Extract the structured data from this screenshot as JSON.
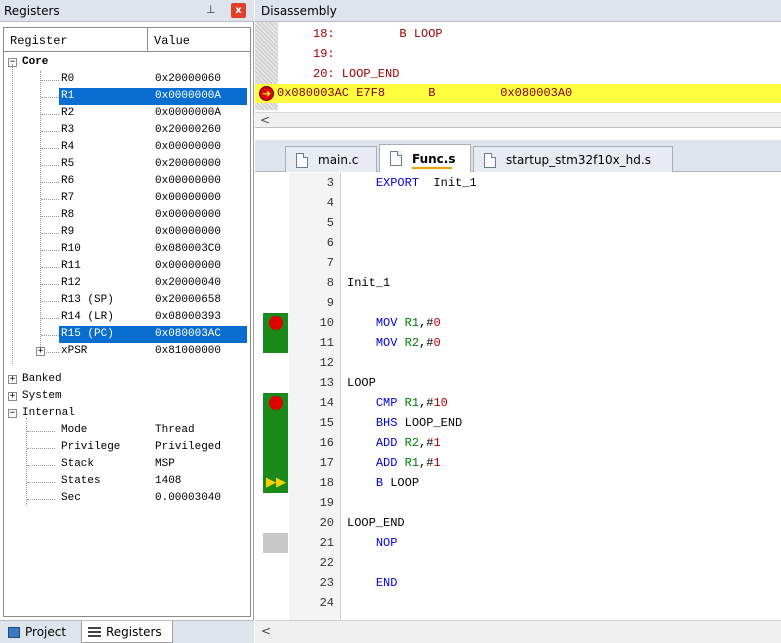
{
  "registers_panel": {
    "title": "Registers",
    "pin_glyph": "⊥",
    "close_glyph": "x",
    "col_register": "Register",
    "col_value": "Value",
    "core_label": "Core",
    "core": [
      {
        "name": "R0",
        "value": "0x20000060"
      },
      {
        "name": "R1",
        "value": "0x0000000A"
      },
      {
        "name": "R2",
        "value": "0x0000000A"
      },
      {
        "name": "R3",
        "value": "0x20000260"
      },
      {
        "name": "R4",
        "value": "0x00000000"
      },
      {
        "name": "R5",
        "value": "0x20000000"
      },
      {
        "name": "R6",
        "value": "0x00000000"
      },
      {
        "name": "R7",
        "value": "0x00000000"
      },
      {
        "name": "R8",
        "value": "0x00000000"
      },
      {
        "name": "R9",
        "value": "0x00000000"
      },
      {
        "name": "R10",
        "value": "0x080003C0"
      },
      {
        "name": "R11",
        "value": "0x00000000"
      },
      {
        "name": "R12",
        "value": "0x20000040"
      },
      {
        "name": "R13 (SP)",
        "value": "0x20000658"
      },
      {
        "name": "R14 (LR)",
        "value": "0x08000393"
      },
      {
        "name": "R15 (PC)",
        "value": "0x080003AC"
      },
      {
        "name": "xPSR",
        "value": "0x81000000"
      }
    ],
    "banked_label": "Banked",
    "system_label": "System",
    "internal_label": "Internal",
    "internal": [
      {
        "name": "Mode",
        "value": "Thread"
      },
      {
        "name": "Privilege",
        "value": "Privileged"
      },
      {
        "name": "Stack",
        "value": "MSP"
      },
      {
        "name": "States",
        "value": "1408"
      },
      {
        "name": "Sec",
        "value": "0.00003040"
      }
    ],
    "tabs": [
      {
        "label": "Project"
      },
      {
        "label": "Registers"
      }
    ]
  },
  "disassembly": {
    "title": "Disassembly",
    "lines": [
      "18:         B LOOP",
      "19:",
      "20: LOOP_END",
      "0x080003AC E7F8      B         0x080003A0"
    ],
    "scroll_left": "<"
  },
  "editor": {
    "tabs": [
      {
        "label": "main.c"
      },
      {
        "label": "Func.s"
      },
      {
        "label": "startup_stm32f10x_hd.s"
      }
    ],
    "lines": [
      {
        "n": "3",
        "t": "    EXPORT  Init_1"
      },
      {
        "n": "4",
        "t": ""
      },
      {
        "n": "5",
        "t": ""
      },
      {
        "n": "6",
        "t": ""
      },
      {
        "n": "7",
        "t": ""
      },
      {
        "n": "8",
        "t": "Init_1"
      },
      {
        "n": "9",
        "t": ""
      },
      {
        "n": "10",
        "t": "    MOV R1,#0"
      },
      {
        "n": "11",
        "t": "    MOV R2,#0"
      },
      {
        "n": "12",
        "t": ""
      },
      {
        "n": "13",
        "t": "LOOP"
      },
      {
        "n": "14",
        "t": "    CMP R1,#10"
      },
      {
        "n": "15",
        "t": "    BHS LOOP_END"
      },
      {
        "n": "16",
        "t": "    ADD R2,#1"
      },
      {
        "n": "17",
        "t": "    ADD R1,#1"
      },
      {
        "n": "18",
        "t": "    B LOOP"
      },
      {
        "n": "19",
        "t": ""
      },
      {
        "n": "20",
        "t": "LOOP_END"
      },
      {
        "n": "21",
        "t": "    NOP"
      },
      {
        "n": "22",
        "t": ""
      },
      {
        "n": "23",
        "t": "    END"
      },
      {
        "n": "24",
        "t": ""
      }
    ],
    "scroll_left": "<"
  },
  "colors": {
    "selection": "#0a6ed1",
    "highlight": "#ffff40",
    "breakpoint": "#e00000",
    "gutter_green": "#1a8a1a"
  }
}
